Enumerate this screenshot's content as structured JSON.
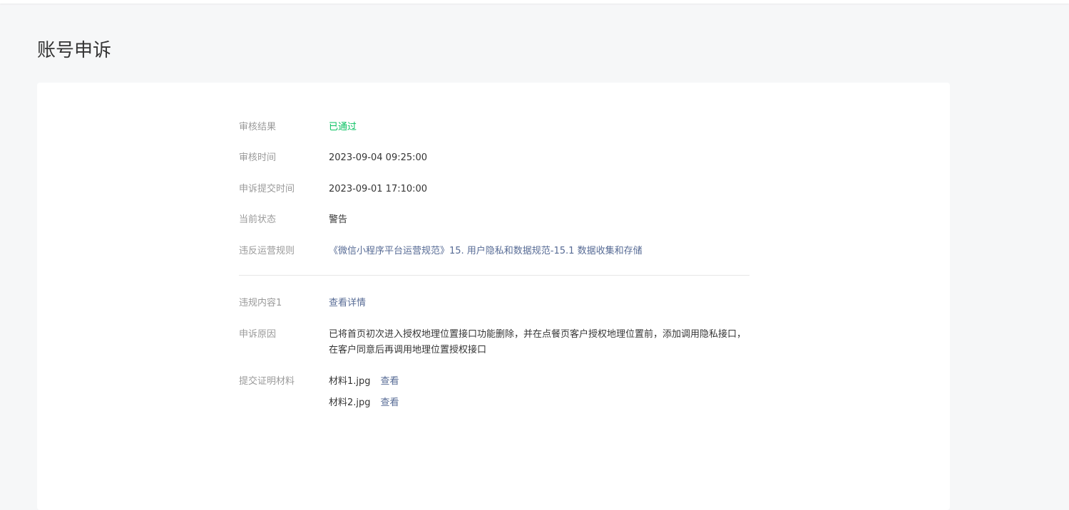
{
  "page": {
    "title": "账号申诉"
  },
  "colors": {
    "success": "#07c160",
    "link": "#576b95",
    "label": "#9a9a9a",
    "text": "#353535"
  },
  "review": {
    "result_label": "审核结果",
    "result_value": "已通过",
    "time_label": "审核时间",
    "time_value": "2023-09-04 09:25:00",
    "submit_label": "申诉提交时间",
    "submit_value": "2023-09-01 17:10:00",
    "status_label": "当前状态",
    "status_value": "警告",
    "rule_label": "违反运营规则",
    "rule_value": "《微信小程序平台运营规范》15. 用户隐私和数据规范-15.1 数据收集和存储"
  },
  "appeal": {
    "content_label": "违规内容1",
    "content_link": "查看详情",
    "reason_label": "申诉原因",
    "reason_value": "已将首页初次进入授权地理位置接口功能删除，并在点餐页客户授权地理位置前，添加调用隐私接口，在客户同意后再调用地理位置授权接口",
    "materials_label": "提交证明材料",
    "materials": [
      {
        "name": "材料1.jpg",
        "action": "查看"
      },
      {
        "name": "材料2.jpg",
        "action": "查看"
      }
    ]
  }
}
